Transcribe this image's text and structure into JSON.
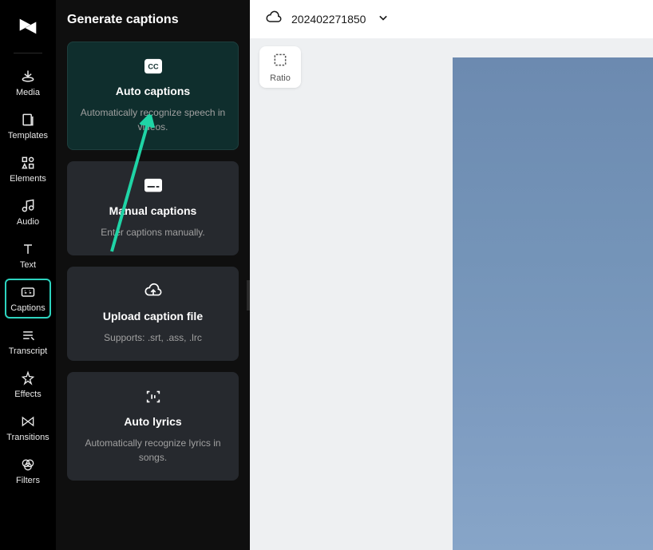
{
  "sidebar": {
    "items": [
      {
        "id": "media",
        "label": "Media"
      },
      {
        "id": "templates",
        "label": "Templates"
      },
      {
        "id": "elements",
        "label": "Elements"
      },
      {
        "id": "audio",
        "label": "Audio"
      },
      {
        "id": "text",
        "label": "Text"
      },
      {
        "id": "captions",
        "label": "Captions"
      },
      {
        "id": "transcript",
        "label": "Transcript"
      },
      {
        "id": "effects",
        "label": "Effects"
      },
      {
        "id": "transitions",
        "label": "Transitions"
      },
      {
        "id": "filters",
        "label": "Filters"
      }
    ]
  },
  "panel": {
    "title": "Generate captions",
    "cards": [
      {
        "id": "auto",
        "title": "Auto captions",
        "desc": "Automatically recognize speech in videos."
      },
      {
        "id": "manual",
        "title": "Manual captions",
        "desc": "Enter captions manually."
      },
      {
        "id": "upload",
        "title": "Upload caption file",
        "desc": "Supports: .srt, .ass, .lrc"
      },
      {
        "id": "lyrics",
        "title": "Auto lyrics",
        "desc": "Automatically recognize lyrics in songs."
      }
    ]
  },
  "topbar": {
    "project_name": "202402271850"
  },
  "canvas": {
    "ratio_label": "Ratio"
  }
}
